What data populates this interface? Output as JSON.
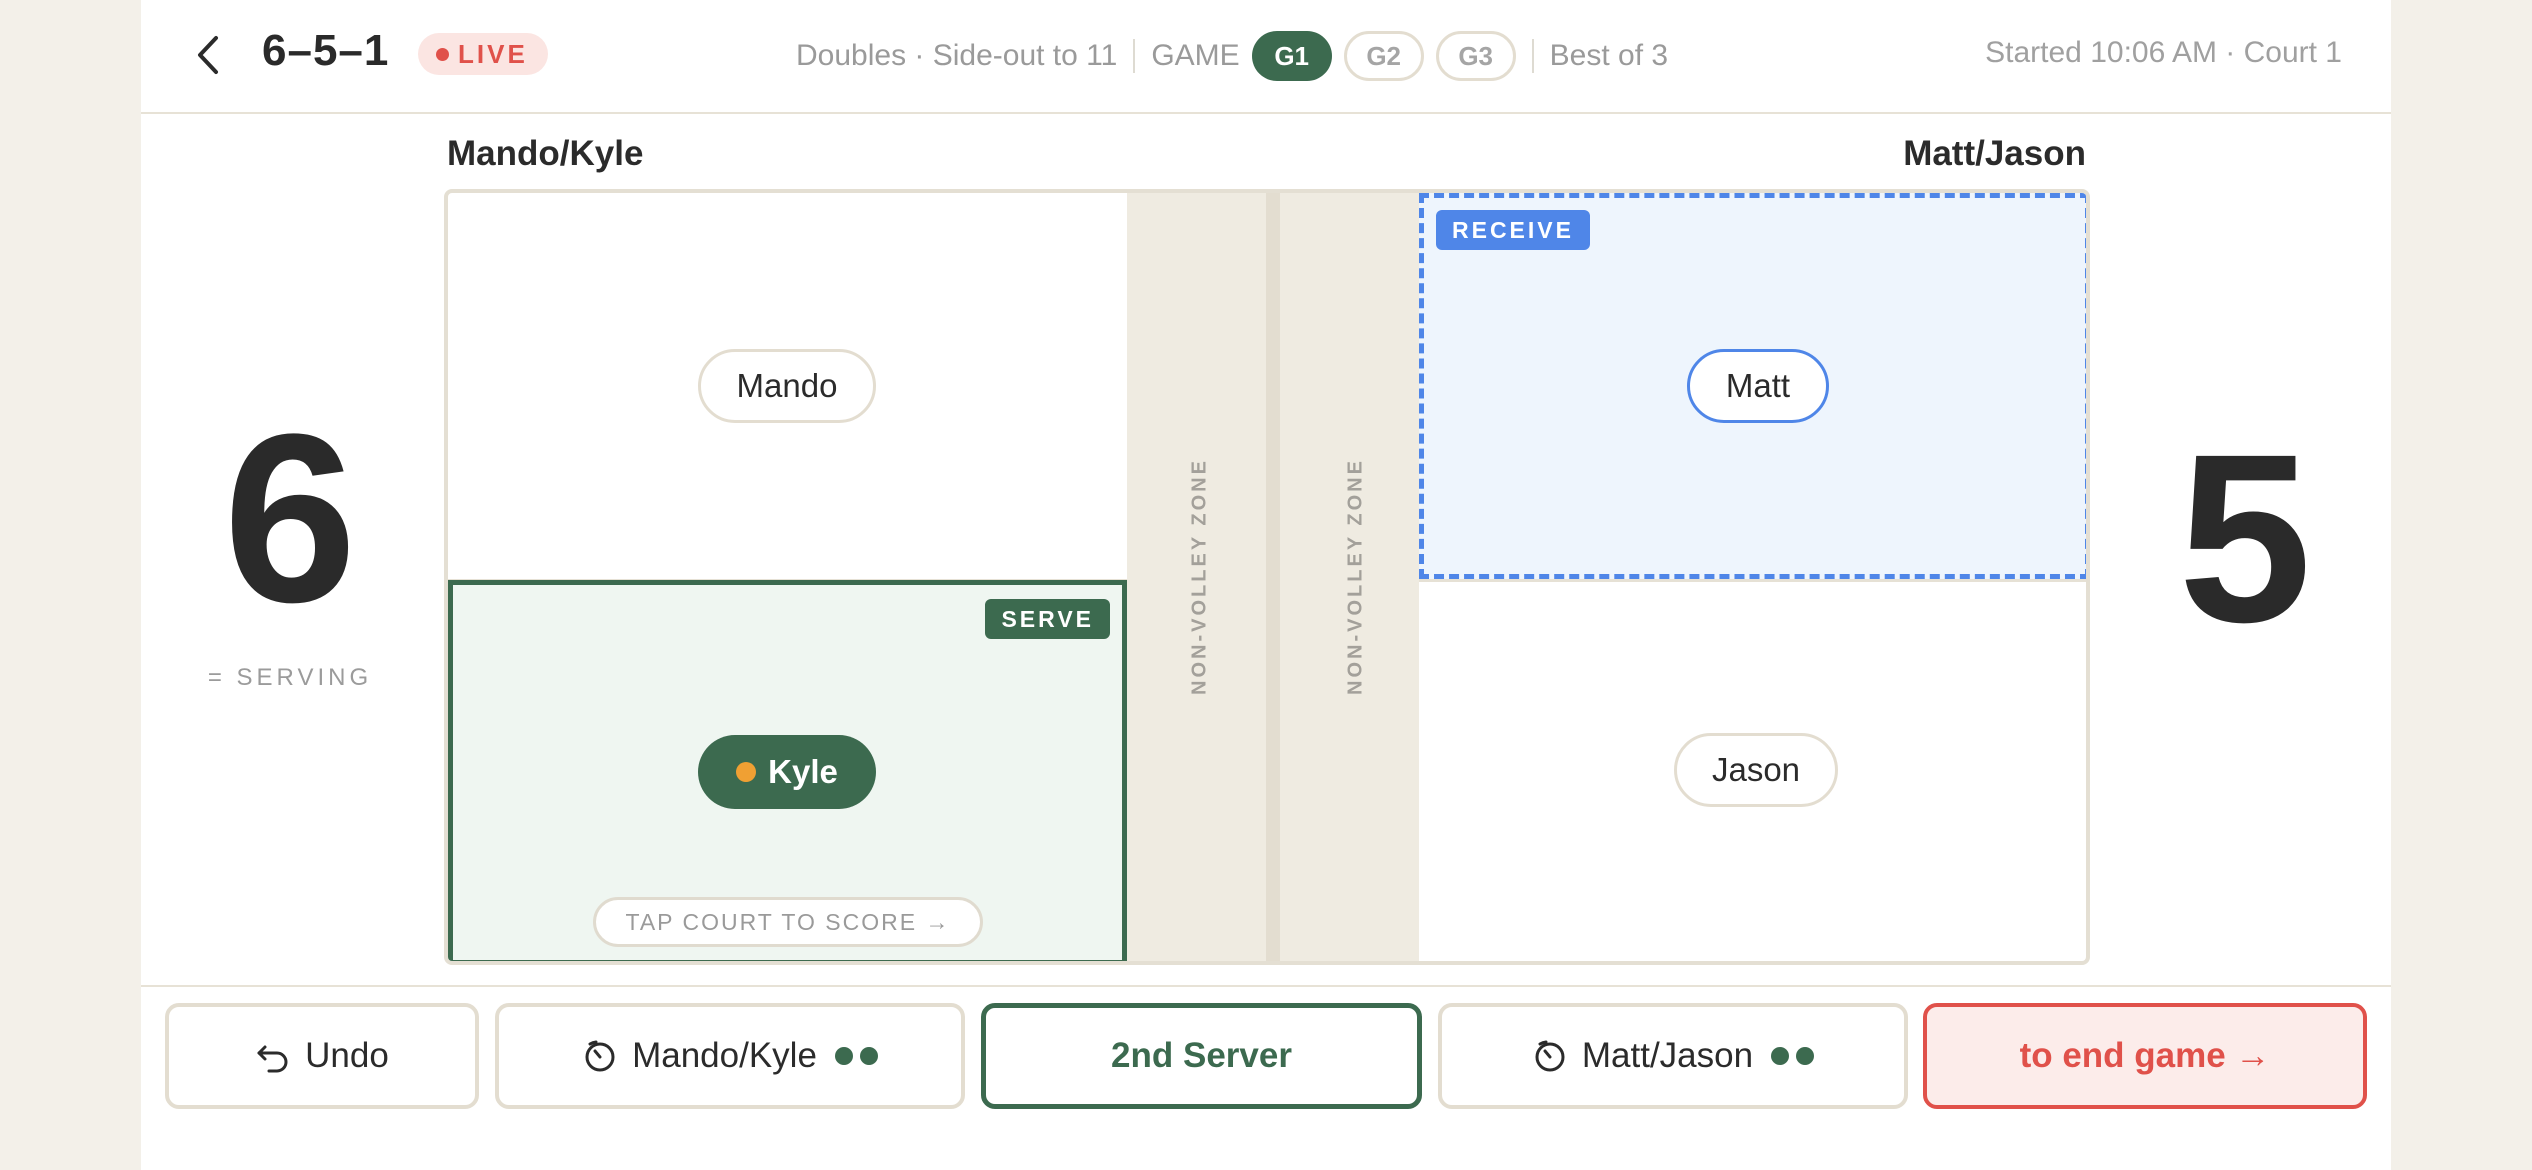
{
  "header": {
    "match_score": "6–5–1",
    "live_label": "LIVE",
    "format": "Doubles · Side-out to 11",
    "game_label": "GAME",
    "games": [
      "G1",
      "G2",
      "G3"
    ],
    "active_game": "G1",
    "series": "Best of 3",
    "started": "Started 10:06 AM · Court 1"
  },
  "teams": {
    "left": {
      "name": "Mando/Kyle",
      "score": "6",
      "status_label": "= SERVING",
      "players": {
        "top": "Mando",
        "bottom": "Kyle"
      }
    },
    "right": {
      "name": "Matt/Jason",
      "score": "5",
      "players": {
        "top": "Matt",
        "bottom": "Jason"
      }
    }
  },
  "court": {
    "nvz_label": "NON-VOLLEY ZONE",
    "serve_tag": "SERVE",
    "receive_tag": "RECEIVE",
    "tap_hint": "TAP COURT TO SCORE →",
    "serving_player": "Kyle",
    "receiving_player": "Matt"
  },
  "footer": {
    "undo": "Undo",
    "timeout_left": "Mando/Kyle",
    "timeouts_left_remaining": 2,
    "second_server": "2nd Server",
    "timeout_right": "Matt/Jason",
    "timeouts_right_remaining": 2,
    "end_game": "to end game →"
  },
  "colors": {
    "accent_green": "#3c6a4f",
    "live_red": "#e0514a",
    "receive_blue": "#4f86e8",
    "server_dot": "#f0a033",
    "background": "#f3f0e9"
  }
}
